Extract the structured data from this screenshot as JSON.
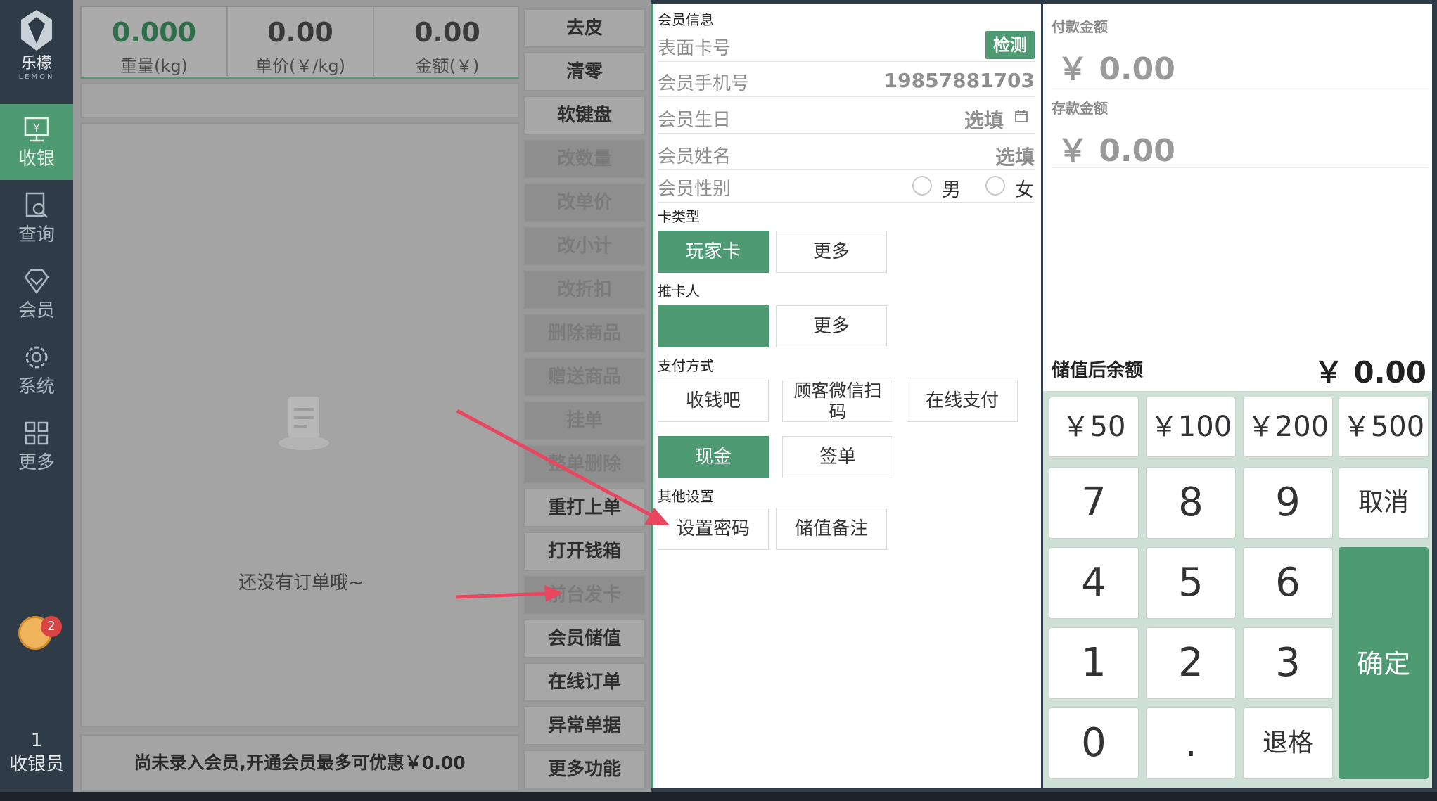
{
  "sidebar": {
    "logo_cn": "乐檬",
    "logo_en": "LEMON",
    "items": [
      {
        "label": "收银",
        "icon": "cashier-icon"
      },
      {
        "label": "查询",
        "icon": "search-doc-icon"
      },
      {
        "label": "会员",
        "icon": "diamond-icon"
      },
      {
        "label": "系统",
        "icon": "gear-icon"
      },
      {
        "label": "更多",
        "icon": "grid-icon"
      }
    ],
    "badge_count": "2",
    "cashier_id": "1",
    "cashier_label": "收银员"
  },
  "scale": {
    "weight": "0.000",
    "weight_label": "重量(kg)",
    "unit_price": "0.00",
    "unit_price_label": "单价(￥/kg)",
    "amount": "0.00",
    "amount_label": "金额(￥)"
  },
  "orders": {
    "empty_text": "还没有订单哦~"
  },
  "promo_text": "尚未录入会员,开通会员最多可优惠￥0.00",
  "function_buttons": [
    {
      "label": "去皮",
      "enabled": true
    },
    {
      "label": "清零",
      "enabled": true
    },
    {
      "label": "软键盘",
      "enabled": true
    },
    {
      "label": "改数量",
      "enabled": false
    },
    {
      "label": "改单价",
      "enabled": false
    },
    {
      "label": "改小计",
      "enabled": false
    },
    {
      "label": "改折扣",
      "enabled": false
    },
    {
      "label": "删除商品",
      "enabled": false
    },
    {
      "label": "赠送商品",
      "enabled": false
    },
    {
      "label": "挂单",
      "enabled": false
    },
    {
      "label": "整单删除",
      "enabled": false
    },
    {
      "label": "重打上单",
      "enabled": true
    },
    {
      "label": "打开钱箱",
      "enabled": true
    },
    {
      "label": "前台发卡",
      "enabled": false
    },
    {
      "label": "会员储值",
      "enabled": true
    },
    {
      "label": "在线订单",
      "enabled": true
    },
    {
      "label": "异常单据",
      "enabled": true
    },
    {
      "label": "更多功能",
      "enabled": true
    }
  ],
  "member": {
    "section_title": "会员信息",
    "card_no_label": "表面卡号",
    "detect_label": "检测",
    "phone_label": "会员手机号",
    "phone_value": "19857881703",
    "birthday_label": "会员生日",
    "birthday_placeholder": "选填",
    "name_label": "会员姓名",
    "name_placeholder": "选填",
    "gender_label": "会员性别",
    "gender_male": "男",
    "gender_female": "女",
    "card_type_title": "卡类型",
    "card_type_selected": "玩家卡",
    "card_type_more": "更多",
    "referrer_title": "推卡人",
    "referrer_value": "",
    "referrer_more": "更多",
    "payment_title": "支付方式",
    "payment_methods": [
      "收钱吧",
      "顾客微信扫码",
      "在线支付",
      "现金",
      "签单"
    ],
    "payment_selected": "现金",
    "payment_wechat_line1": "顾客微信扫",
    "payment_wechat_line2": "码",
    "other_title": "其他设置",
    "set_password": "设置密码",
    "deposit_note": "储值备注"
  },
  "payment": {
    "paid_label": "付款金额",
    "paid_amount": "￥ 0.00",
    "deposit_label": "存款金额",
    "deposit_amount": "￥ 0.00",
    "balance_label": "储值后余额",
    "balance_amount": "￥ 0.00"
  },
  "keypad": {
    "quick": [
      "￥50",
      "￥100",
      "￥200",
      "￥500"
    ],
    "k7": "7",
    "k8": "8",
    "k9": "9",
    "cancel": "取消",
    "k4": "4",
    "k5": "5",
    "k6": "6",
    "confirm": "确定",
    "k1": "1",
    "k2": "2",
    "k3": "3",
    "k0": "0",
    "dot": ".",
    "backspace": "退格"
  },
  "colors": {
    "accent": "#4e9a73",
    "sidebar": "#2f3b47",
    "arrow": "#e8475f"
  }
}
